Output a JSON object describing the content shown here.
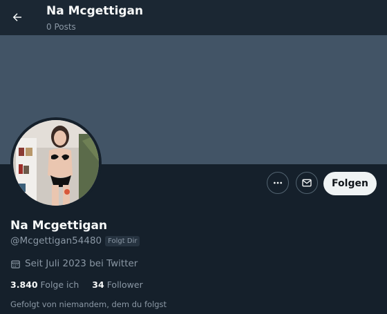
{
  "header": {
    "title": "Na Mcgettigan",
    "subtitle": "0 Posts",
    "back_icon": "arrow-left-icon"
  },
  "colors": {
    "background": "#15202b",
    "banner": "#425466",
    "secondary_text": "#8b98a5",
    "follow_button_bg": "#eff3f4"
  },
  "profile": {
    "name": "Na Mcgettigan",
    "handle": "@Mcgettigan54480",
    "follows_you_badge": "Folgt Dir",
    "joined": "Seit Juli 2023 bei Twitter",
    "following_count": "3.840",
    "following_label": "Folge ich",
    "followers_count": "34",
    "followers_label": "Follower",
    "followed_by_text": "Gefolgt von niemandem, dem du folgst"
  },
  "actions": {
    "more_icon": "more-dots-icon",
    "message_icon": "envelope-icon",
    "follow_label": "Folgen"
  }
}
